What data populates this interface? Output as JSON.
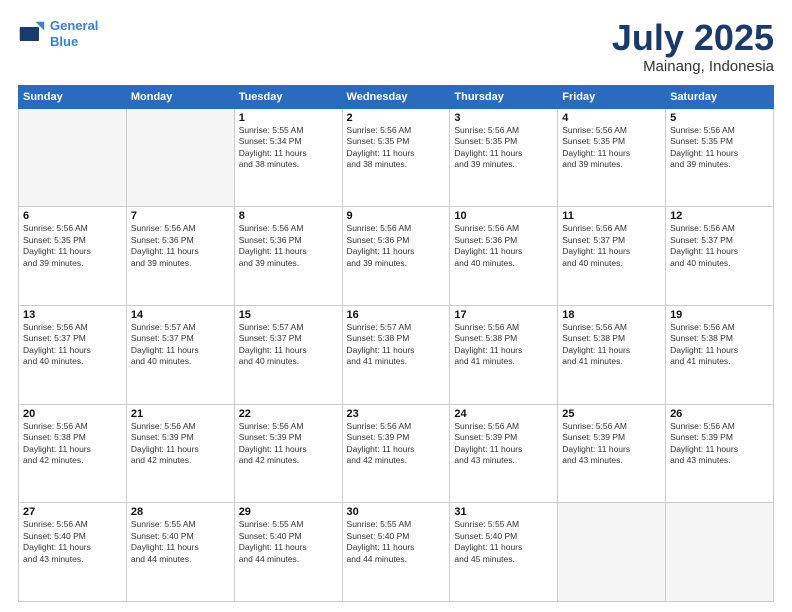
{
  "header": {
    "logo_line1": "General",
    "logo_line2": "Blue",
    "main_title": "July 2025",
    "subtitle": "Mainang, Indonesia"
  },
  "days_of_week": [
    "Sunday",
    "Monday",
    "Tuesday",
    "Wednesday",
    "Thursday",
    "Friday",
    "Saturday"
  ],
  "weeks": [
    [
      {
        "day": "",
        "info": ""
      },
      {
        "day": "",
        "info": ""
      },
      {
        "day": "1",
        "info": "Sunrise: 5:55 AM\nSunset: 5:34 PM\nDaylight: 11 hours\nand 38 minutes."
      },
      {
        "day": "2",
        "info": "Sunrise: 5:56 AM\nSunset: 5:35 PM\nDaylight: 11 hours\nand 38 minutes."
      },
      {
        "day": "3",
        "info": "Sunrise: 5:56 AM\nSunset: 5:35 PM\nDaylight: 11 hours\nand 39 minutes."
      },
      {
        "day": "4",
        "info": "Sunrise: 5:56 AM\nSunset: 5:35 PM\nDaylight: 11 hours\nand 39 minutes."
      },
      {
        "day": "5",
        "info": "Sunrise: 5:56 AM\nSunset: 5:35 PM\nDaylight: 11 hours\nand 39 minutes."
      }
    ],
    [
      {
        "day": "6",
        "info": "Sunrise: 5:56 AM\nSunset: 5:35 PM\nDaylight: 11 hours\nand 39 minutes."
      },
      {
        "day": "7",
        "info": "Sunrise: 5:56 AM\nSunset: 5:36 PM\nDaylight: 11 hours\nand 39 minutes."
      },
      {
        "day": "8",
        "info": "Sunrise: 5:56 AM\nSunset: 5:36 PM\nDaylight: 11 hours\nand 39 minutes."
      },
      {
        "day": "9",
        "info": "Sunrise: 5:56 AM\nSunset: 5:36 PM\nDaylight: 11 hours\nand 39 minutes."
      },
      {
        "day": "10",
        "info": "Sunrise: 5:56 AM\nSunset: 5:36 PM\nDaylight: 11 hours\nand 40 minutes."
      },
      {
        "day": "11",
        "info": "Sunrise: 5:56 AM\nSunset: 5:37 PM\nDaylight: 11 hours\nand 40 minutes."
      },
      {
        "day": "12",
        "info": "Sunrise: 5:56 AM\nSunset: 5:37 PM\nDaylight: 11 hours\nand 40 minutes."
      }
    ],
    [
      {
        "day": "13",
        "info": "Sunrise: 5:56 AM\nSunset: 5:37 PM\nDaylight: 11 hours\nand 40 minutes."
      },
      {
        "day": "14",
        "info": "Sunrise: 5:57 AM\nSunset: 5:37 PM\nDaylight: 11 hours\nand 40 minutes."
      },
      {
        "day": "15",
        "info": "Sunrise: 5:57 AM\nSunset: 5:37 PM\nDaylight: 11 hours\nand 40 minutes."
      },
      {
        "day": "16",
        "info": "Sunrise: 5:57 AM\nSunset: 5:38 PM\nDaylight: 11 hours\nand 41 minutes."
      },
      {
        "day": "17",
        "info": "Sunrise: 5:56 AM\nSunset: 5:38 PM\nDaylight: 11 hours\nand 41 minutes."
      },
      {
        "day": "18",
        "info": "Sunrise: 5:56 AM\nSunset: 5:38 PM\nDaylight: 11 hours\nand 41 minutes."
      },
      {
        "day": "19",
        "info": "Sunrise: 5:56 AM\nSunset: 5:38 PM\nDaylight: 11 hours\nand 41 minutes."
      }
    ],
    [
      {
        "day": "20",
        "info": "Sunrise: 5:56 AM\nSunset: 5:38 PM\nDaylight: 11 hours\nand 42 minutes."
      },
      {
        "day": "21",
        "info": "Sunrise: 5:56 AM\nSunset: 5:39 PM\nDaylight: 11 hours\nand 42 minutes."
      },
      {
        "day": "22",
        "info": "Sunrise: 5:56 AM\nSunset: 5:39 PM\nDaylight: 11 hours\nand 42 minutes."
      },
      {
        "day": "23",
        "info": "Sunrise: 5:56 AM\nSunset: 5:39 PM\nDaylight: 11 hours\nand 42 minutes."
      },
      {
        "day": "24",
        "info": "Sunrise: 5:56 AM\nSunset: 5:39 PM\nDaylight: 11 hours\nand 43 minutes."
      },
      {
        "day": "25",
        "info": "Sunrise: 5:56 AM\nSunset: 5:39 PM\nDaylight: 11 hours\nand 43 minutes."
      },
      {
        "day": "26",
        "info": "Sunrise: 5:56 AM\nSunset: 5:39 PM\nDaylight: 11 hours\nand 43 minutes."
      }
    ],
    [
      {
        "day": "27",
        "info": "Sunrise: 5:56 AM\nSunset: 5:40 PM\nDaylight: 11 hours\nand 43 minutes."
      },
      {
        "day": "28",
        "info": "Sunrise: 5:55 AM\nSunset: 5:40 PM\nDaylight: 11 hours\nand 44 minutes."
      },
      {
        "day": "29",
        "info": "Sunrise: 5:55 AM\nSunset: 5:40 PM\nDaylight: 11 hours\nand 44 minutes."
      },
      {
        "day": "30",
        "info": "Sunrise: 5:55 AM\nSunset: 5:40 PM\nDaylight: 11 hours\nand 44 minutes."
      },
      {
        "day": "31",
        "info": "Sunrise: 5:55 AM\nSunset: 5:40 PM\nDaylight: 11 hours\nand 45 minutes."
      },
      {
        "day": "",
        "info": ""
      },
      {
        "day": "",
        "info": ""
      }
    ]
  ]
}
